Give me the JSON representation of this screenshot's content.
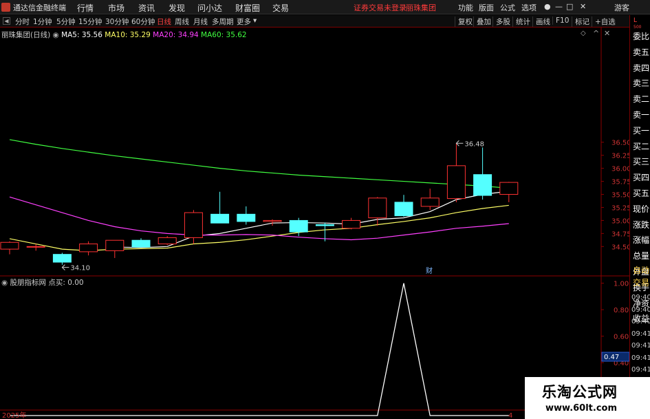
{
  "window": {
    "app_title": "通达信金融终端",
    "menu": [
      "行情",
      "市场",
      "资讯",
      "发现",
      "问小达",
      "财富圈",
      "交易"
    ],
    "notice": "证券交易未登录",
    "stock_link": "丽珠集团",
    "right_menu": [
      "功能",
      "版面",
      "公式",
      "选项"
    ],
    "guest": "游客"
  },
  "periods": {
    "tabs": [
      "分时",
      "1分钟",
      "5分钟",
      "15分钟",
      "30分钟",
      "60分钟",
      "日线",
      "周线",
      "月线",
      "多周期",
      "更多"
    ],
    "active": "日线",
    "right_buttons": [
      "复权",
      "叠加",
      "多股",
      "统计",
      "画线",
      "F10",
      "标记",
      "+自选"
    ]
  },
  "main_chart": {
    "stock_label": "丽珠集团(日线)",
    "ma": [
      {
        "label": "MA5: 35.56",
        "color": "#ffffff"
      },
      {
        "label": "MA10: 35.29",
        "color": "#ffff66"
      },
      {
        "label": "MA20: 34.94",
        "color": "#ff40ff"
      },
      {
        "label": "MA60: 35.62",
        "color": "#40ff40"
      }
    ],
    "high_label": "36.48",
    "low_label": "34.10",
    "event_marker": "财"
  },
  "sub_chart": {
    "indicator_label": "股朋指标网 点买: 0.00",
    "current_value_label": "0.47"
  },
  "axis_labels": {
    "bottom_year": "2025年",
    "bottom_right": "4"
  },
  "right_panel": {
    "header": [
      "L",
      "500"
    ],
    "captions_top": [
      "委比",
      "卖五",
      "卖四",
      "卖三",
      "卖二",
      "卖一",
      "买一",
      "买二",
      "买三",
      "买四",
      "买五",
      "现价",
      "涨跌",
      "涨幅",
      "总量",
      "外盘",
      "换手",
      "净资",
      "收益"
    ],
    "captions_bottom": [
      "自动",
      "交易"
    ],
    "times": [
      "09:40",
      "09:40",
      "09:40",
      "09:41",
      "09:41",
      "09:41",
      "09:41",
      "09:41"
    ]
  },
  "watermark": {
    "title": "乐淘公式网",
    "url": "www.60lt.com"
  },
  "chart_data": [
    {
      "type": "candlestick",
      "title": "丽珠集团(日线)",
      "ylim": [
        33.95,
        38.7
      ],
      "yticks": [
        34.5,
        34.75,
        35.0,
        35.25,
        35.5,
        35.75,
        36.0,
        36.25,
        36.5
      ],
      "candles": [
        {
          "o": 34.45,
          "h": 34.6,
          "l": 34.35,
          "c": 34.58
        },
        {
          "o": 34.5,
          "h": 34.55,
          "l": 34.42,
          "c": 34.5
        },
        {
          "o": 34.35,
          "h": 34.38,
          "l": 34.15,
          "c": 34.2
        },
        {
          "o": 34.4,
          "h": 34.6,
          "l": 34.33,
          "c": 34.55
        },
        {
          "o": 34.42,
          "h": 34.62,
          "l": 34.28,
          "c": 34.62
        },
        {
          "o": 34.62,
          "h": 34.66,
          "l": 34.5,
          "c": 34.49
        },
        {
          "o": 34.55,
          "h": 34.7,
          "l": 34.53,
          "c": 34.67
        },
        {
          "o": 34.67,
          "h": 35.2,
          "l": 34.55,
          "c": 35.15
        },
        {
          "o": 35.12,
          "h": 35.55,
          "l": 34.95,
          "c": 34.95
        },
        {
          "o": 35.12,
          "h": 35.27,
          "l": 34.92,
          "c": 34.98
        },
        {
          "o": 34.98,
          "h": 35.02,
          "l": 34.9,
          "c": 35.0
        },
        {
          "o": 35.0,
          "h": 35.05,
          "l": 34.7,
          "c": 34.78
        },
        {
          "o": 34.92,
          "h": 34.96,
          "l": 34.6,
          "c": 34.9
        },
        {
          "o": 34.85,
          "h": 35.05,
          "l": 34.83,
          "c": 35.0
        },
        {
          "o": 35.05,
          "h": 35.45,
          "l": 34.9,
          "c": 35.43
        },
        {
          "o": 35.35,
          "h": 35.49,
          "l": 35.07,
          "c": 35.09
        },
        {
          "o": 35.27,
          "h": 35.61,
          "l": 35.2,
          "c": 35.43
        },
        {
          "o": 35.42,
          "h": 36.48,
          "l": 35.35,
          "c": 36.05
        },
        {
          "o": 35.88,
          "h": 36.4,
          "l": 35.4,
          "c": 35.48
        },
        {
          "o": 35.5,
          "h": 35.74,
          "l": 35.35,
          "c": 35.73
        }
      ],
      "series": [
        {
          "name": "MA5",
          "color": "#ffffff",
          "values": [
            null,
            null,
            null,
            null,
            34.49,
            34.48,
            34.5,
            34.7,
            34.75,
            34.85,
            34.95,
            34.96,
            34.95,
            34.93,
            35.02,
            35.05,
            35.17,
            35.4,
            35.5,
            35.56
          ]
        },
        {
          "name": "MA10",
          "color": "#ffff66",
          "values": [
            34.65,
            34.55,
            34.45,
            34.42,
            34.45,
            34.46,
            34.47,
            34.55,
            34.58,
            34.63,
            34.7,
            34.77,
            34.82,
            34.85,
            34.92,
            34.98,
            35.05,
            35.15,
            35.23,
            35.29
          ]
        },
        {
          "name": "MA20",
          "color": "#ff40ff",
          "values": [
            35.45,
            35.3,
            35.15,
            35.0,
            34.88,
            34.8,
            34.75,
            34.72,
            34.72,
            34.73,
            34.72,
            34.68,
            34.65,
            34.63,
            34.66,
            34.72,
            34.78,
            34.85,
            34.89,
            34.94
          ]
        },
        {
          "name": "MA60",
          "color": "#40ff40",
          "values": [
            36.55,
            36.46,
            36.38,
            36.31,
            36.24,
            36.18,
            36.12,
            36.06,
            36.0,
            35.95,
            35.91,
            35.87,
            35.84,
            35.81,
            35.78,
            35.75,
            35.72,
            35.69,
            35.66,
            35.62
          ]
        }
      ]
    },
    {
      "type": "line",
      "title": "股朋指标网 点买: 0.00",
      "ylim": [
        0.0,
        1.05
      ],
      "yticks": [
        0.4,
        0.6,
        0.8,
        1.0
      ],
      "series": [
        {
          "name": "点买",
          "color": "#ffffff",
          "values": [
            0,
            0,
            0,
            0,
            0,
            0,
            0,
            0,
            0,
            0,
            0,
            0,
            0,
            0,
            0,
            1,
            0,
            0,
            0,
            0
          ]
        }
      ]
    }
  ]
}
